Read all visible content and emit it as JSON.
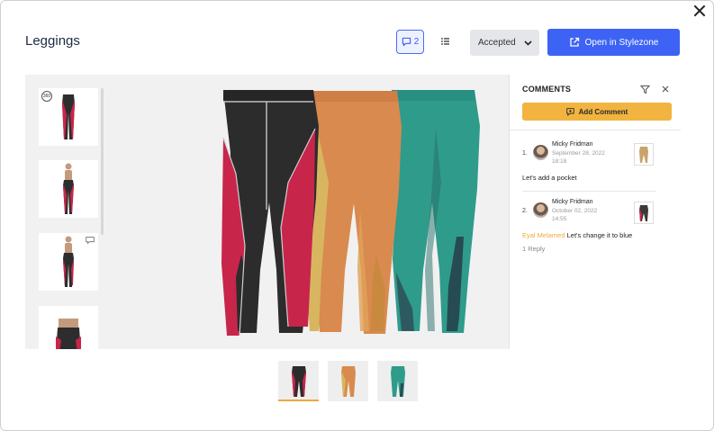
{
  "header": {
    "title": "Leggings",
    "comment_count": "2",
    "status_value": "Accepted",
    "open_button_label": "Open in Stylezone"
  },
  "comments_panel": {
    "title": "COMMENTS",
    "add_comment_label": "Add Comment",
    "comments": [
      {
        "index": "1.",
        "author": "Micky Fridman",
        "date": "September 28, 2022",
        "time": "18:18",
        "text": "Let's add a pocket",
        "thumb_color": "#c9a36b"
      },
      {
        "index": "2.",
        "author": "Micky Fridman",
        "date": "October 02, 2022",
        "time": "14:55",
        "mention": "Eyal Melamed",
        "text": "Let's change it to blue",
        "replies": "1 Reply",
        "thumb_color": "#3a3a3a"
      }
    ]
  },
  "viewer": {
    "thumbnails": [
      {
        "label": "thumbnail-360",
        "icon": "360-icon"
      },
      {
        "label": "thumbnail-front"
      },
      {
        "label": "thumbnail-front-comment",
        "icon": "comment-icon"
      },
      {
        "label": "thumbnail-back"
      }
    ],
    "colorways": [
      {
        "name": "black-red",
        "main": "#2c2c2c",
        "accent": "#c8254a"
      },
      {
        "name": "orange-yellow",
        "main": "#d98a4e",
        "accent": "#d8b65f"
      },
      {
        "name": "teal",
        "main": "#2f9b8b",
        "accent": "#264b52"
      }
    ]
  },
  "colors": {
    "primary": "#3d63f5",
    "accent": "#f2b440",
    "mention": "#f2a93a"
  }
}
